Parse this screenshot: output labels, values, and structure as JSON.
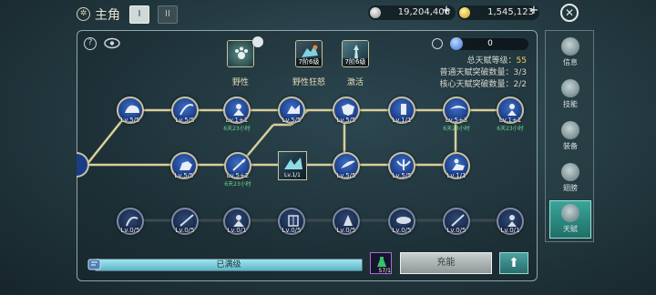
{
  "header": {
    "title": "主角",
    "tabs": [
      "I",
      "II"
    ],
    "currency": [
      {
        "name": "silver",
        "amount": "19,204,406"
      },
      {
        "name": "gold",
        "amount": "1,545,123"
      }
    ]
  },
  "talent": {
    "skills": [
      {
        "label": "野性",
        "rank": ""
      },
      {
        "label": "野性狂怒",
        "rank": "7阶6级"
      },
      {
        "label": "激活",
        "rank": "7阶6级"
      }
    ],
    "points": "0",
    "info": [
      {
        "label": "总天赋等级：",
        "value": "55"
      },
      {
        "label": "普通天赋突破数量：",
        "value": "3/3"
      },
      {
        "label": "核心天赋突破数量：",
        "value": "2/2"
      }
    ],
    "row1": [
      {
        "lv": "Lv.5/5",
        "timer": ""
      },
      {
        "lv": "Lv.5/5",
        "timer": ""
      },
      {
        "lv": "Lv.1+1",
        "timer": "6天23小时"
      },
      {
        "lv": "Lv.5/5",
        "timer": ""
      },
      {
        "lv": "Lv.5/5",
        "timer": ""
      },
      {
        "lv": "Lv.1/1",
        "timer": ""
      },
      {
        "lv": "Lv.5+3",
        "timer": "6天23小时"
      },
      {
        "lv": "Lv.1+1",
        "timer": "6天23小时"
      }
    ],
    "row2": [
      {
        "lv": "Lv.5/5",
        "timer": ""
      },
      {
        "lv": "Lv.5+2",
        "timer": "6天23小时"
      },
      {
        "lv": "Lv.1/1",
        "timer": ""
      },
      {
        "lv": "Lv.5/5",
        "timer": ""
      },
      {
        "lv": "Lv.5/5",
        "timer": ""
      },
      {
        "lv": "Lv.1/1",
        "timer": ""
      }
    ],
    "row3": [
      {
        "lv": "Lv.0/5"
      },
      {
        "lv": "Lv.0/5"
      },
      {
        "lv": "Lv.0/1"
      },
      {
        "lv": "Lv.0/5"
      },
      {
        "lv": "Lv.0/5"
      },
      {
        "lv": "Lv.0/5"
      },
      {
        "lv": "Lv.0/5"
      },
      {
        "lv": "Lv.0/1"
      }
    ],
    "progress_label": "已满级",
    "progress": 1.0,
    "item_count": "57/1",
    "charge_label": "充能"
  },
  "sidebar": {
    "items": [
      {
        "label": "信息",
        "icon": "info-icon"
      },
      {
        "label": "技能",
        "icon": "skill-icon"
      },
      {
        "label": "装备",
        "icon": "equip-icon"
      },
      {
        "label": "翅膀",
        "icon": "wing-icon"
      },
      {
        "label": "天赋",
        "icon": "talent-icon"
      }
    ],
    "active": 4
  },
  "colors": {
    "accent": "#3aa59a",
    "timer": "#69d88a",
    "gold": "#f2d35a"
  }
}
